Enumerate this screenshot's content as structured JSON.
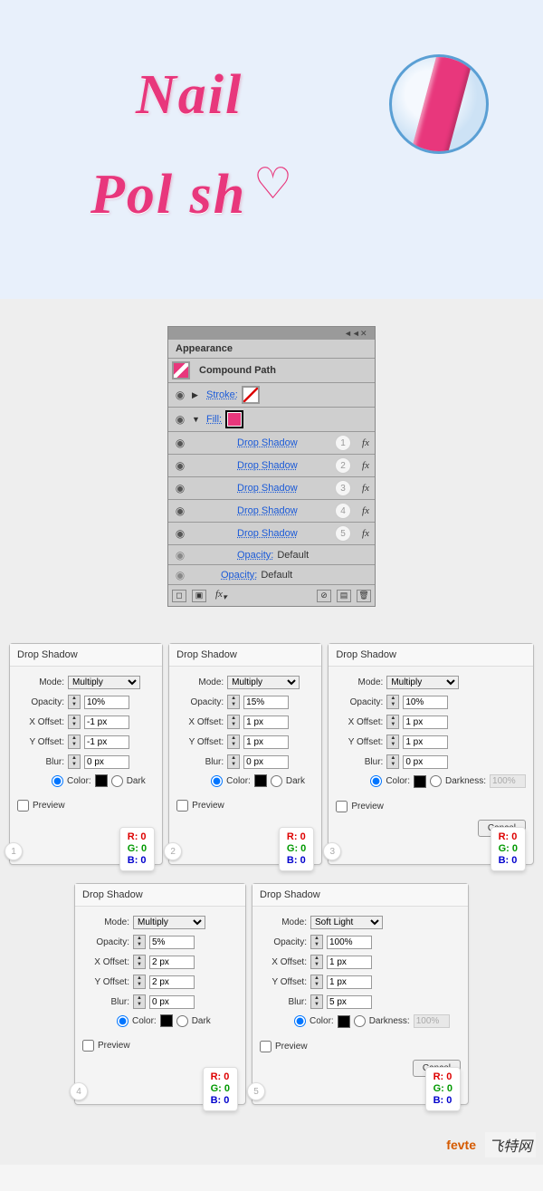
{
  "hero": {
    "line1": "Nail",
    "line2": "Pol  sh"
  },
  "panel": {
    "tab": "Appearance",
    "title": "Compound Path",
    "stroke_label": "Stroke:",
    "fill_label": "Fill:",
    "opacity_label": "Opacity:",
    "opacity_value": "Default",
    "effects": [
      {
        "label": "Drop Shadow",
        "num": "1"
      },
      {
        "label": "Drop Shadow",
        "num": "2"
      },
      {
        "label": "Drop Shadow",
        "num": "3"
      },
      {
        "label": "Drop Shadow",
        "num": "4"
      },
      {
        "label": "Drop Shadow",
        "num": "5"
      }
    ],
    "fx_label": "fx"
  },
  "dialogs": [
    {
      "num": "1",
      "title": "Drop Shadow",
      "mode": "Multiply",
      "opacity": "10%",
      "xoffset": "-1 px",
      "yoffset": "-1 px",
      "blur": "0 px",
      "rgb": {
        "r": "0",
        "g": "0",
        "b": "0"
      },
      "wide": false
    },
    {
      "num": "2",
      "title": "Drop Shadow",
      "mode": "Multiply",
      "opacity": "15%",
      "xoffset": "1 px",
      "yoffset": "1 px",
      "blur": "0 px",
      "rgb": {
        "r": "0",
        "g": "0",
        "b": "0"
      },
      "wide": false
    },
    {
      "num": "3",
      "title": "Drop Shadow",
      "mode": "Multiply",
      "opacity": "10%",
      "xoffset": "1 px",
      "yoffset": "1 px",
      "blur": "0 px",
      "rgb": {
        "r": "0",
        "g": "0",
        "b": "0"
      },
      "wide": true,
      "darkness": "100%"
    },
    {
      "num": "4",
      "title": "Drop Shadow",
      "mode": "Multiply",
      "opacity": "5%",
      "xoffset": "2 px",
      "yoffset": "2 px",
      "blur": "0 px",
      "rgb": {
        "r": "0",
        "g": "0",
        "b": "0"
      },
      "wide": false
    },
    {
      "num": "5",
      "title": "Drop Shadow",
      "mode": "Soft Light",
      "opacity": "100%",
      "xoffset": "1 px",
      "yoffset": "1 px",
      "blur": "5 px",
      "rgb": {
        "r": "0",
        "g": "0",
        "b": "0"
      },
      "wide": true,
      "darkness": "100%"
    }
  ],
  "labels": {
    "mode": "Mode:",
    "opacity": "Opacity:",
    "xoffset": "X Offset:",
    "yoffset": "Y Offset:",
    "blur": "Blur:",
    "color": "Color:",
    "darkness": "Darkness:",
    "dark_short": "Dark",
    "preview": "Preview",
    "cancel": "Cancel",
    "rgb_r": "R:",
    "rgb_g": "G:",
    "rgb_b": "B:"
  },
  "footer": {
    "logo1": "fevte",
    "logo2": "飞特网"
  }
}
